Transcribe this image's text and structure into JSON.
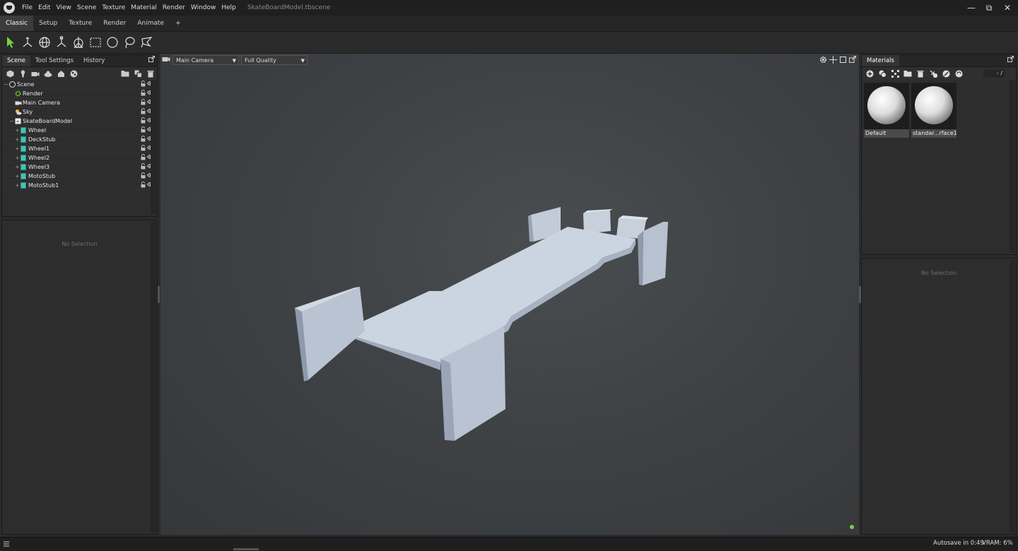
{
  "app": {
    "menu": [
      "File",
      "Edit",
      "View",
      "Scene",
      "Texture",
      "Material",
      "Render",
      "Window",
      "Help"
    ],
    "document_title": "SkateBoardModel.tbscene"
  },
  "window_controls": {
    "minimize": "—",
    "maximize": "⧉",
    "close": "✕"
  },
  "workspace_tabs": [
    "Classic",
    "Setup",
    "Texture",
    "Render",
    "Animate",
    "+"
  ],
  "left_panel": {
    "tabs": [
      "Scene",
      "Tool Settings",
      "History"
    ],
    "tree": [
      {
        "label": "Scene",
        "indent": 0,
        "icon": "scene"
      },
      {
        "label": "Render",
        "indent": 1,
        "icon": "gear"
      },
      {
        "label": "Main Camera",
        "indent": 1,
        "icon": "camera"
      },
      {
        "label": "Sky",
        "indent": 1,
        "icon": "sky"
      },
      {
        "label": "SkateBoardModel",
        "indent": 1,
        "icon": "model"
      },
      {
        "label": "Wheel",
        "indent": 2,
        "icon": "cube"
      },
      {
        "label": "DeckStub",
        "indent": 2,
        "icon": "cube"
      },
      {
        "label": "Wheel1",
        "indent": 2,
        "icon": "cube"
      },
      {
        "label": "Wheel2",
        "indent": 2,
        "icon": "cube"
      },
      {
        "label": "Wheel3",
        "indent": 2,
        "icon": "cube"
      },
      {
        "label": "MotoStub",
        "indent": 2,
        "icon": "cube"
      },
      {
        "label": "MotoStub1",
        "indent": 2,
        "icon": "cube"
      }
    ],
    "properties_empty": "No Selection"
  },
  "viewport": {
    "camera": "Main Camera",
    "quality": "Full Quality"
  },
  "right_panel": {
    "tab": "Materials",
    "page_indicator": "- /",
    "materials": [
      "Default",
      "standar...rface1"
    ],
    "properties_empty": "No Selection"
  },
  "status": {
    "autosave": "Autosave in 0:49",
    "vram": "VRAM: 6%"
  },
  "colors": {
    "accent_green": "#7ad13b",
    "cube_teal": "#4ac0b6"
  }
}
